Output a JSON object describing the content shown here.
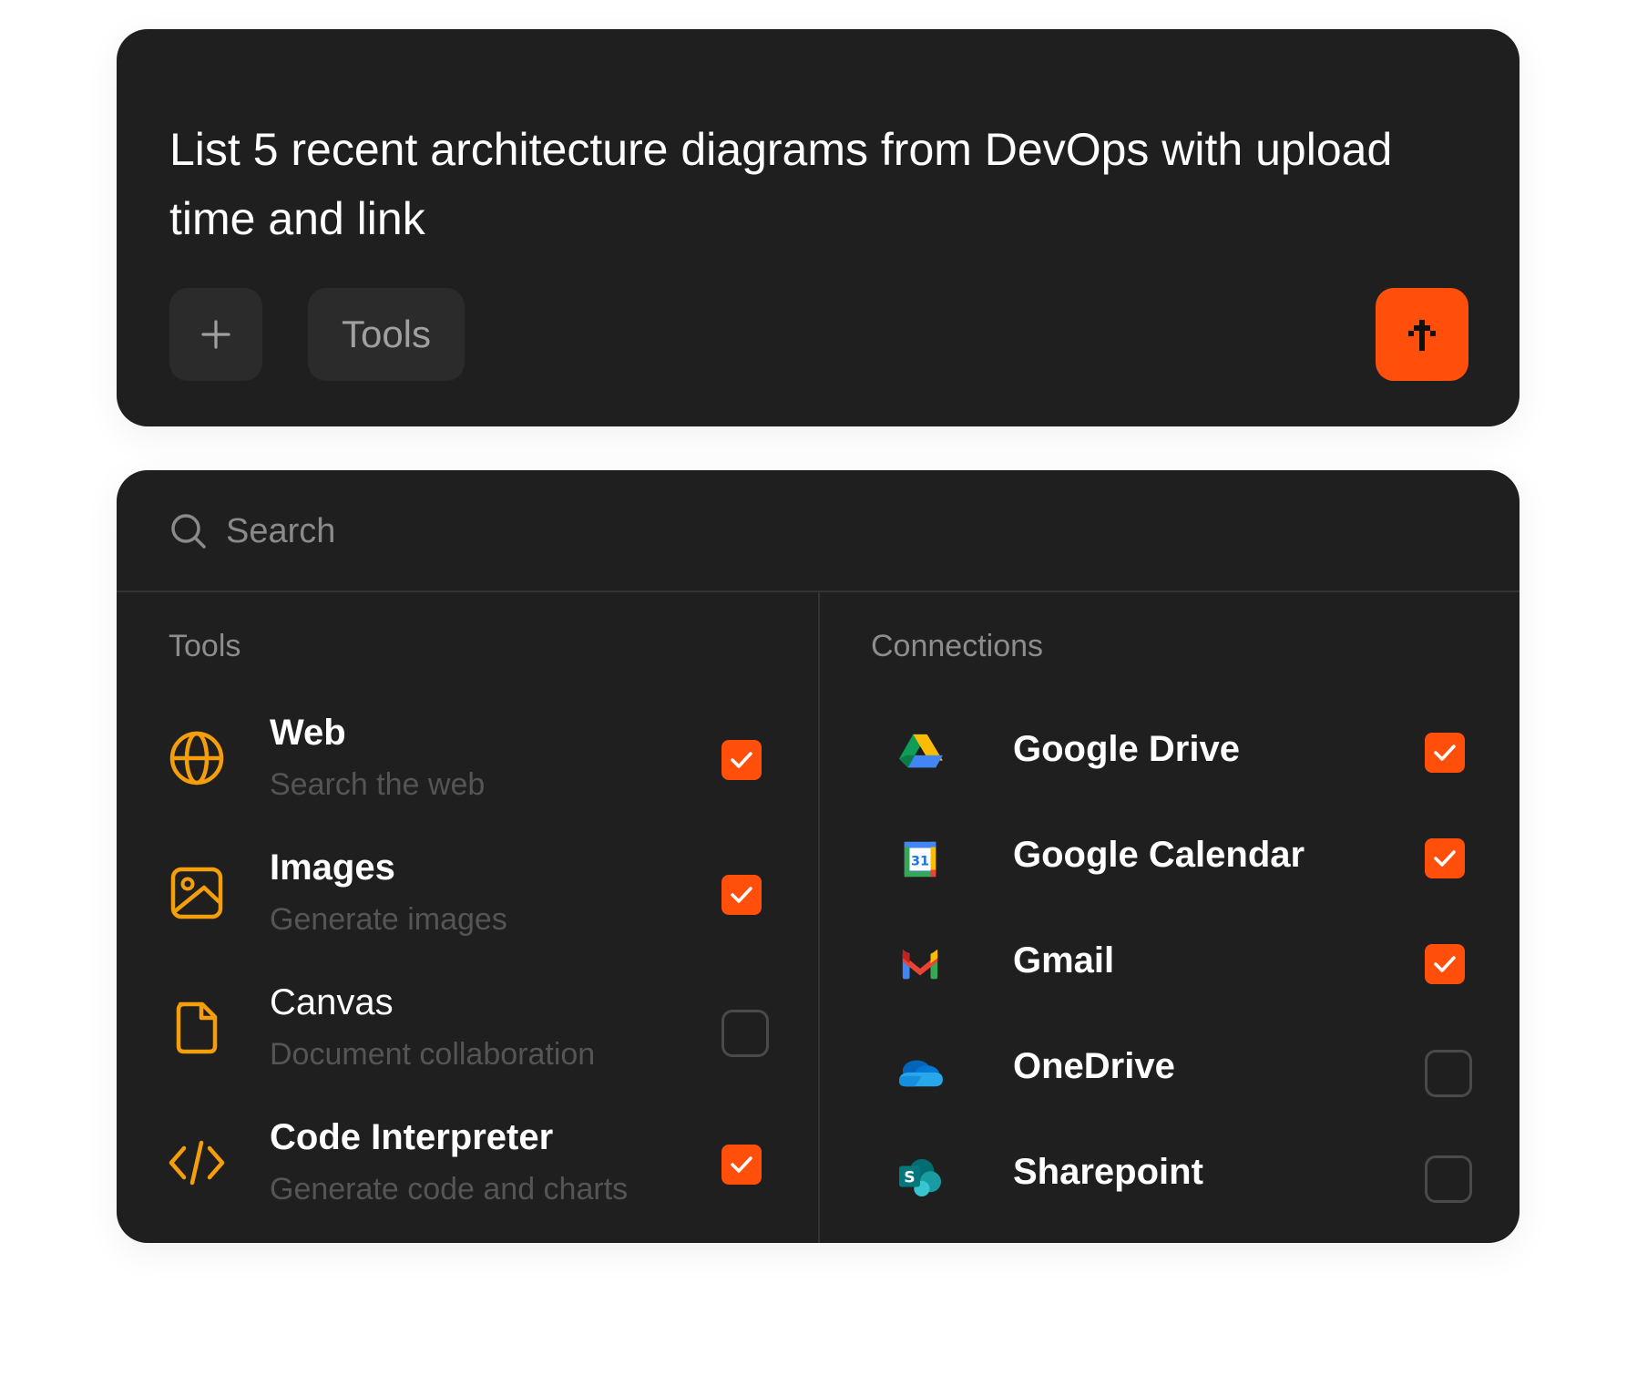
{
  "composer": {
    "prompt": "List 5 recent architecture diagrams from DevOps with upload time and link",
    "add_label": "+",
    "tools_label": "Tools"
  },
  "panel": {
    "search": {
      "placeholder": "Search",
      "value": ""
    },
    "tools_title": "Tools",
    "connections_title": "Connections",
    "tools": [
      {
        "name": "Web",
        "description": "Search the web",
        "icon": "globe-icon",
        "checked": true
      },
      {
        "name": "Images",
        "description": "Generate images",
        "icon": "image-icon",
        "checked": true
      },
      {
        "name": "Canvas",
        "description": "Document collaboration",
        "icon": "document-icon",
        "checked": false
      },
      {
        "name": "Code Interpreter",
        "description": "Generate code and charts",
        "icon": "code-icon",
        "checked": true
      }
    ],
    "connections": [
      {
        "name": "Google Drive",
        "icon": "google-drive-icon",
        "checked": true
      },
      {
        "name": "Google Calendar",
        "icon": "google-calendar-icon",
        "checked": true
      },
      {
        "name": "Gmail",
        "icon": "gmail-icon",
        "checked": true
      },
      {
        "name": "OneDrive",
        "icon": "onedrive-icon",
        "checked": false
      },
      {
        "name": "Sharepoint",
        "icon": "sharepoint-icon",
        "checked": false
      }
    ]
  },
  "colors": {
    "accent": "#ff4f0b",
    "icon_orange": "#f59e0b",
    "card": "#1f1f1f"
  }
}
